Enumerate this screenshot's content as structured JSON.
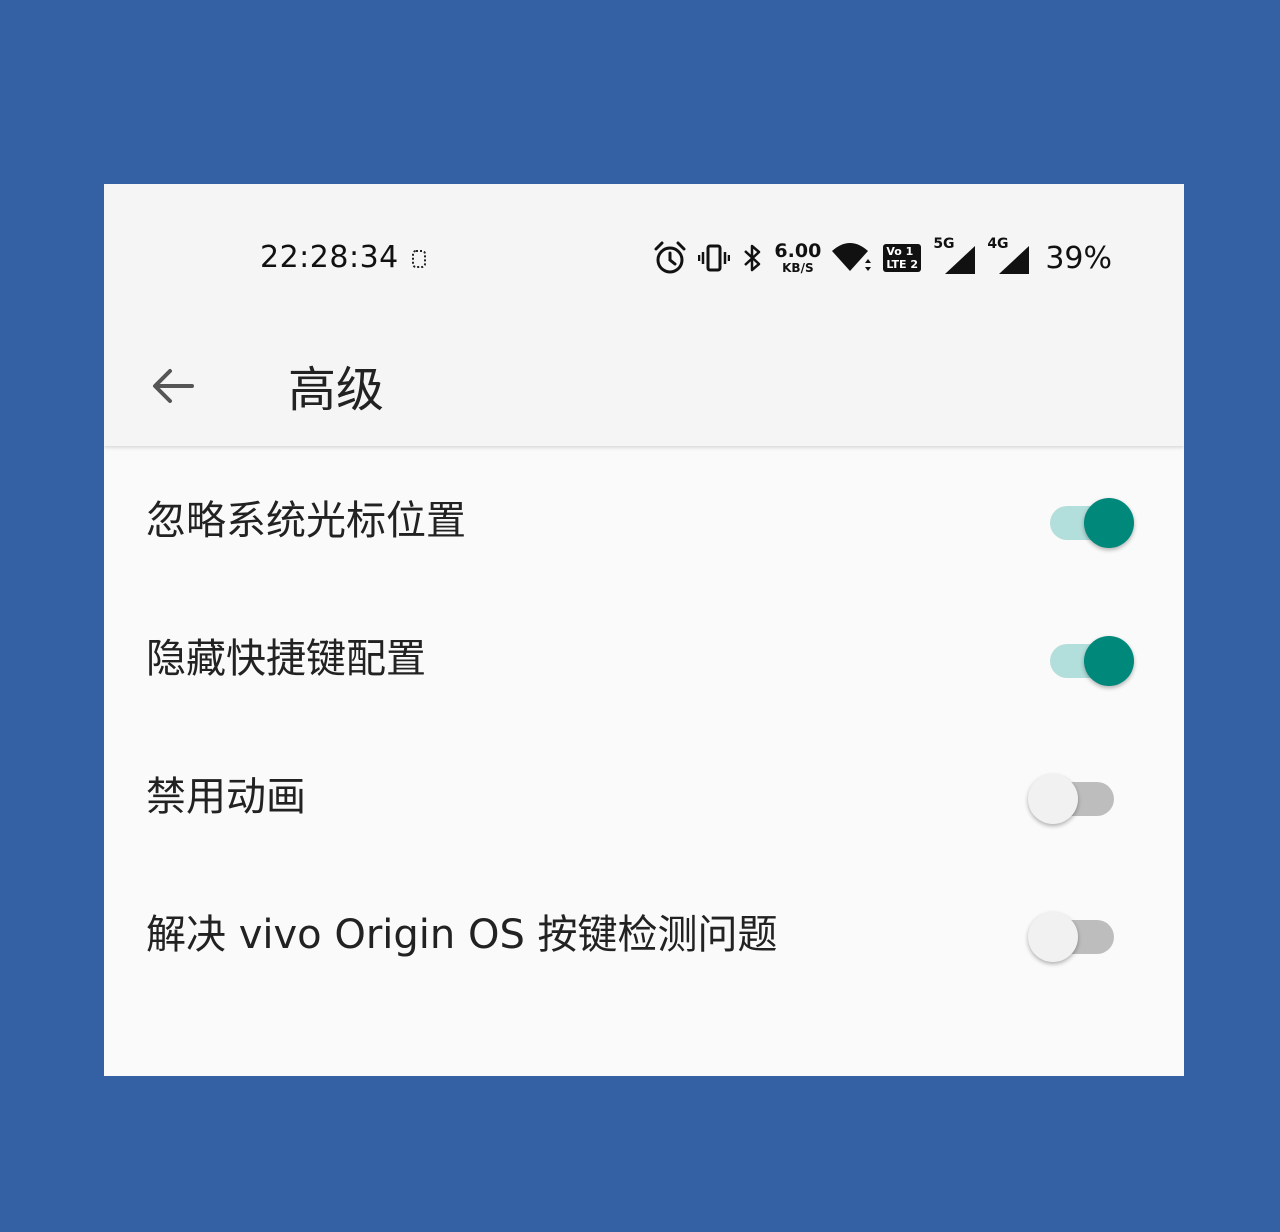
{
  "status_bar": {
    "time": "22:28:34",
    "net_speed_value": "6.00",
    "net_speed_unit": "KB/S",
    "volte_label": "Vo 1 LTE 2",
    "signal_1_label": "5G",
    "signal_2_label": "4G",
    "battery": "39%",
    "icons": [
      "dot-indicator-icon",
      "alarm-icon",
      "vibrate-icon",
      "bluetooth-icon",
      "wifi-icon",
      "volte-icon",
      "signal-5g-icon",
      "signal-4g-icon"
    ]
  },
  "app_bar": {
    "title": "高级",
    "back_icon": "arrow-back-icon"
  },
  "settings": [
    {
      "label": "忽略系统光标位置",
      "enabled": true
    },
    {
      "label": "隐藏快捷键配置",
      "enabled": true
    },
    {
      "label": "禁用动画",
      "enabled": false
    },
    {
      "label": "解决 vivo Origin OS 按键检测问题",
      "enabled": false
    }
  ],
  "colors": {
    "background": "#3461a3",
    "switch_on_thumb": "#00897b",
    "switch_on_track": "#b2dfdb",
    "switch_off_thumb": "#f1f1f1",
    "switch_off_track": "#bdbdbd"
  }
}
